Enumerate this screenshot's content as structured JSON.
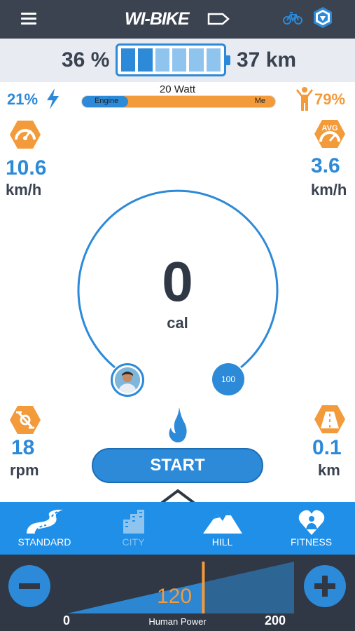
{
  "app": {
    "title": "WI-BIKE"
  },
  "header": {
    "menu_icon": "hamburger-icon",
    "bike_icon": "bicycle-icon",
    "badge_icon": "piaggio-logo-icon"
  },
  "battery": {
    "percent_text": "36 %",
    "range_text": "37 km",
    "level": 0.36,
    "color": "#2c8ad8"
  },
  "power_split": {
    "engine_text": "21%",
    "engine_fraction": 0.21,
    "watt_text": "20 Watt",
    "engine_label": "Engine",
    "me_label": "Me",
    "me_text": "79%",
    "engine_color": "#2c8ad8",
    "me_color": "#f39a3a"
  },
  "metrics": {
    "speed": {
      "value": "10.6",
      "unit": "km/h",
      "icon": "speedometer-icon"
    },
    "avg_speed": {
      "value": "3.6",
      "unit": "km/h",
      "icon": "avg-speedometer-icon",
      "icon_text": "AVG"
    },
    "cadence": {
      "value": "18",
      "unit": "rpm",
      "icon": "pedal-crank-icon"
    },
    "distance": {
      "value": "0.1",
      "unit": "km",
      "icon": "road-icon"
    }
  },
  "gauge": {
    "value": "0",
    "unit": "cal",
    "target_text": "100",
    "avatar": "user-avatar"
  },
  "start_button": {
    "label": "START"
  },
  "modes": [
    {
      "label": "STANDARD",
      "icon": "road-curve-icon",
      "active": true
    },
    {
      "label": "CITY",
      "icon": "city-buildings-icon",
      "active": false
    },
    {
      "label": "HILL",
      "icon": "mountains-icon",
      "active": true
    },
    {
      "label": "FITNESS",
      "icon": "heart-person-icon",
      "active": true
    }
  ],
  "human_power": {
    "label": "Human Power",
    "value": "120",
    "min": "0",
    "max": "200",
    "fraction": 0.6
  }
}
